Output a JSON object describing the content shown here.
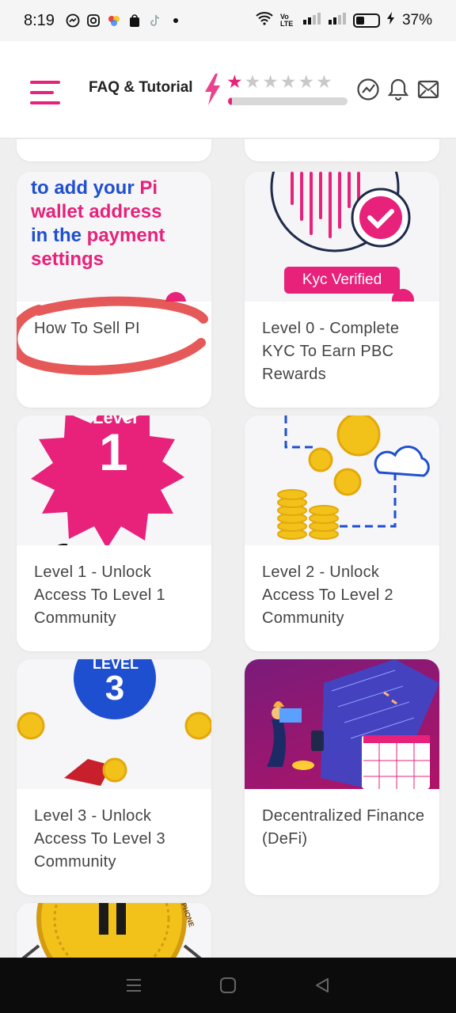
{
  "status_bar": {
    "time": "8:19",
    "network_label": "Vo LTE",
    "battery_percent": "37%",
    "battery_level": 0.37
  },
  "header": {
    "title": "FAQ & Tutorial",
    "rating": {
      "filled": 1,
      "total": 6
    },
    "progress": 0.03,
    "icons": [
      "levels-icon",
      "bell-icon",
      "mail-icon"
    ],
    "accent_color": "#e8217a"
  },
  "cards": [
    {
      "label": "How To Sell PI",
      "image": {
        "line1": "to add your",
        "line1b": "Pi",
        "line2": "wallet address",
        "line3": "in the",
        "line3b": "payment",
        "line4": "settings"
      }
    },
    {
      "label": "Level 0 - Complete KYC To Earn PBC Rewards",
      "image": {
        "badge": "Kyc Verified"
      }
    },
    {
      "label": "Level 1 - Unlock Access To Level 1 Community",
      "image": {
        "heading": "Level",
        "number": "1"
      }
    },
    {
      "label": "Level 2 - Unlock Access To Level 2 Community",
      "image": {}
    },
    {
      "label": "Level 3 - Unlock Access To Level 3 Community",
      "image": {
        "heading": "LEVEL",
        "number": "3"
      }
    },
    {
      "label": "Decentralized Finance (DeFi)",
      "image": {}
    },
    {
      "label": "",
      "image": {
        "side_text": "PHONE"
      }
    }
  ]
}
